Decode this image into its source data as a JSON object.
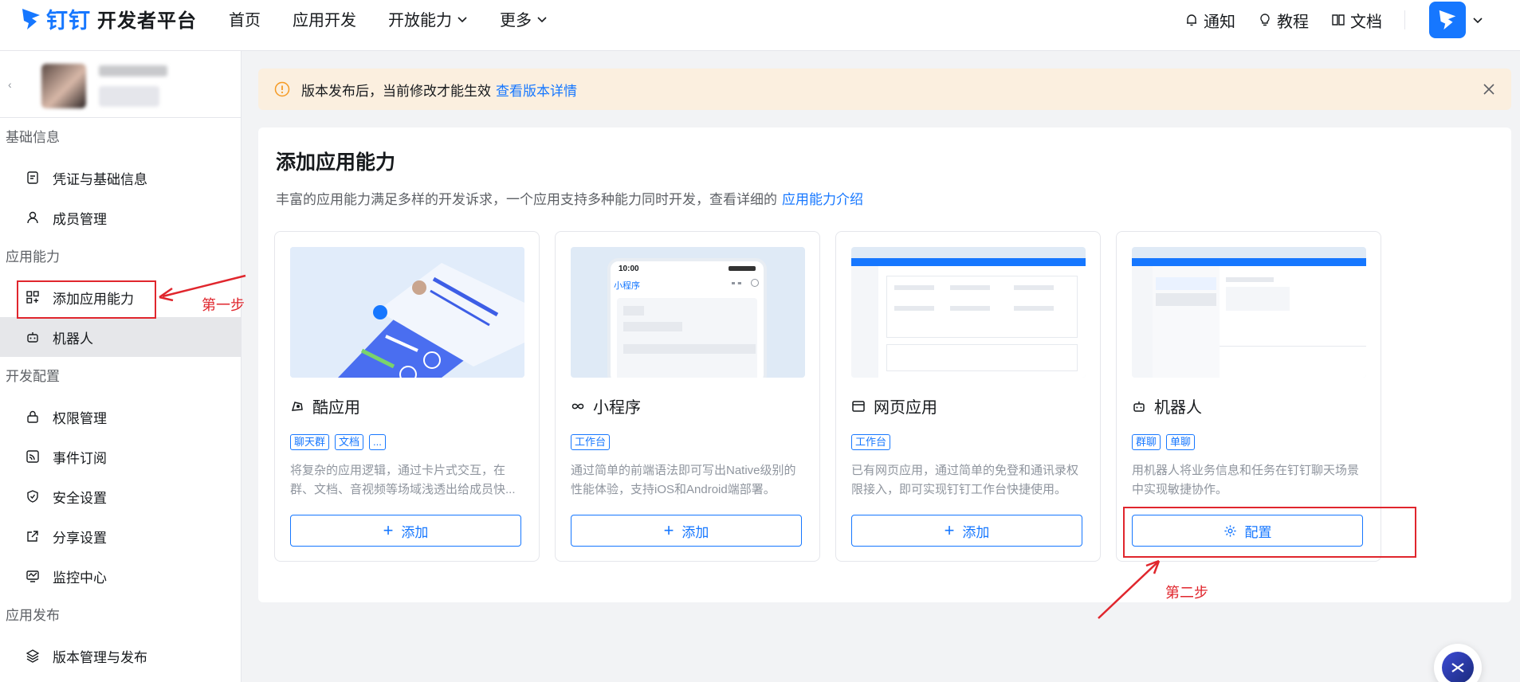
{
  "brand": {
    "logo_text": "钉钉",
    "title": "开发者平台"
  },
  "nav": {
    "items": [
      "首页",
      "应用开发",
      "开放能力",
      "更多"
    ]
  },
  "tools": {
    "notify": "通知",
    "tutorial": "教程",
    "docs": "文档"
  },
  "sidebar": {
    "back": "‹",
    "groups": [
      {
        "label": "基础信息",
        "items": [
          "凭证与基础信息",
          "成员管理"
        ]
      },
      {
        "label": "应用能力",
        "items": [
          "添加应用能力",
          "机器人"
        ]
      },
      {
        "label": "开发配置",
        "items": [
          "权限管理",
          "事件订阅",
          "安全设置",
          "分享设置",
          "监控中心"
        ]
      },
      {
        "label": "应用发布",
        "items": [
          "版本管理与发布"
        ]
      }
    ],
    "active_item": "机器人",
    "highlighted_item": "添加应用能力"
  },
  "notice": {
    "text": "版本发布后，当前修改才能生效",
    "link": "查看版本详情"
  },
  "panel": {
    "title": "添加应用能力",
    "desc": "丰富的应用能力满足多样的开发诉求，一个应用支持多种能力同时开发，查看详细的",
    "desc_link": "应用能力介绍"
  },
  "cards": [
    {
      "title": "酷应用",
      "icon": "cool-app-icon",
      "tags": [
        "聊天群",
        "文档",
        "..."
      ],
      "desc": "将复杂的应用逻辑，通过卡片式交互，在群、文档、音视频等场域浅透出给成员快...",
      "button": "添加"
    },
    {
      "title": "小程序",
      "icon": "infinity-icon",
      "tags": [
        "工作台"
      ],
      "desc": "通过简单的前端语法即可写出Native级别的性能体验，支持iOS和Android端部署。",
      "button": "添加",
      "preview": {
        "time": "10:00",
        "title": "小程序"
      }
    },
    {
      "title": "网页应用",
      "icon": "browser-icon",
      "tags": [
        "工作台"
      ],
      "desc": "已有网页应用，通过简单的免登和通讯录权限接入，即可实现钉钉工作台快捷使用。",
      "button": "添加"
    },
    {
      "title": "机器人",
      "icon": "robot-icon",
      "tags": [
        "群聊",
        "单聊"
      ],
      "desc": "用机器人将业务信息和任务在钉钉聊天场景中实现敏捷协作。",
      "button": "配置"
    }
  ],
  "annotations": {
    "step1": "第一步",
    "step2": "第二步"
  },
  "colors": {
    "primary": "#1677ff",
    "annotation": "#e0262d",
    "notice_bg": "#fbefdf"
  }
}
